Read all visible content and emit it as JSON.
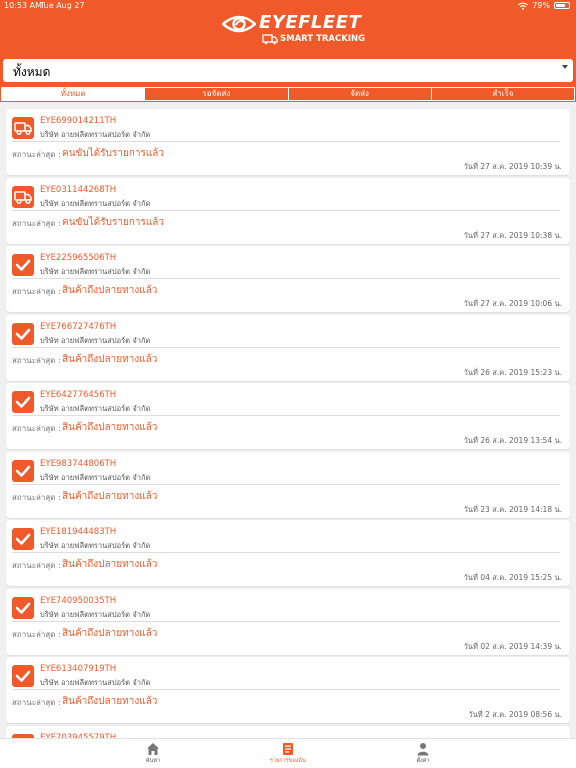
{
  "status_bar": {
    "time": "10:53 AM",
    "date": "Tue Aug 27",
    "battery": "79%",
    "battery_level": 0.79
  },
  "brand": {
    "name": "EYEFLEET",
    "tagline": "SMART TRACKING"
  },
  "colors": {
    "accent": "#f05a2a",
    "background": "#f0f0f0"
  },
  "filter": {
    "selected": "ทั้งหมด"
  },
  "tabs": [
    {
      "label": "ทั้งหมด",
      "active": true
    },
    {
      "label": "รอจัดส่ง",
      "active": false
    },
    {
      "label": "จัดส่ง",
      "active": false
    },
    {
      "label": "สำเร็จ",
      "active": false
    }
  ],
  "orders": [
    {
      "icon": "truck-icon",
      "code": "EYE699014211TH",
      "company": "บริษัท อายฟลีตทรานสปอร์ต จำกัด",
      "status_label": "สถานะล่าสุด :",
      "status": "คนขับได้รับรายการแล้ว",
      "date": "วันที่ 27 ส.ค. 2019 10:39 น."
    },
    {
      "icon": "truck-icon",
      "code": "EYE031144268TH",
      "company": "บริษัท อายฟลีตทรานสปอร์ต จำกัด",
      "status_label": "สถานะล่าสุด :",
      "status": "คนขับได้รับรายการแล้ว",
      "date": "วันที่ 27 ส.ค. 2019 10:38 น."
    },
    {
      "icon": "check-icon",
      "code": "EYE225965506TH",
      "company": "บริษัท อายฟลีตทรานสปอร์ต จำกัด",
      "status_label": "สถานะล่าสุด :",
      "status": "สินค้าถึงปลายทางแล้ว",
      "date": "วันที่ 27 ส.ค. 2019 10:06 น."
    },
    {
      "icon": "check-icon",
      "code": "EYE766727476TH",
      "company": "บริษัท อายฟลีตทรานสปอร์ต จำกัด",
      "status_label": "สถานะล่าสุด :",
      "status": "สินค้าถึงปลายทางแล้ว",
      "date": "วันที่ 26 ส.ค. 2019 15:23 น."
    },
    {
      "icon": "check-icon",
      "code": "EYE642776456TH",
      "company": "บริษัท อายฟลีตทรานสปอร์ต จำกัด",
      "status_label": "สถานะล่าสุด :",
      "status": "สินค้าถึงปลายทางแล้ว",
      "date": "วันที่ 26 ส.ค. 2019 13:54 น."
    },
    {
      "icon": "check-icon",
      "code": "EYE983744806TH",
      "company": "บริษัท อายฟลีตทรานสปอร์ต จำกัด",
      "status_label": "สถานะล่าสุด :",
      "status": "สินค้าถึงปลายทางแล้ว",
      "date": "วันที่ 23 ส.ค. 2019 14:18 น."
    },
    {
      "icon": "check-icon",
      "code": "EYE181944483TH",
      "company": "บริษัท อายฟลีตทรานสปอร์ต จำกัด",
      "status_label": "สถานะล่าสุด :",
      "status": "สินค้าถึงปลายทางแล้ว",
      "date": "วันที่ 04 ส.ค. 2019 15:25 น."
    },
    {
      "icon": "check-icon",
      "code": "EYE740950035TH",
      "company": "บริษัท อายฟลีตทรานสปอร์ต จำกัด",
      "status_label": "สถานะล่าสุด :",
      "status": "สินค้าถึงปลายทางแล้ว",
      "date": "วันที่ 02 ส.ค. 2019 14:39 น."
    },
    {
      "icon": "check-icon",
      "code": "EYE613407919TH",
      "company": "บริษัท อายฟลีตทรานสปอร์ต จำกัด",
      "status_label": "สถานะล่าสุด :",
      "status": "สินค้าถึงปลายทางแล้ว",
      "date": "วันที่ 2 ส.ค. 2019 08:56 น."
    },
    {
      "icon": "check-icon",
      "code": "EYE703945579TH",
      "company": "",
      "status_label": "",
      "status": "",
      "date": ""
    }
  ],
  "bottom_nav": [
    {
      "icon": "home-icon",
      "label": "ค้นหา",
      "active": false
    },
    {
      "icon": "list-icon",
      "label": "รายการของฉัน",
      "active": true
    },
    {
      "icon": "person-icon",
      "label": "ตั้งค่า",
      "active": false
    }
  ]
}
